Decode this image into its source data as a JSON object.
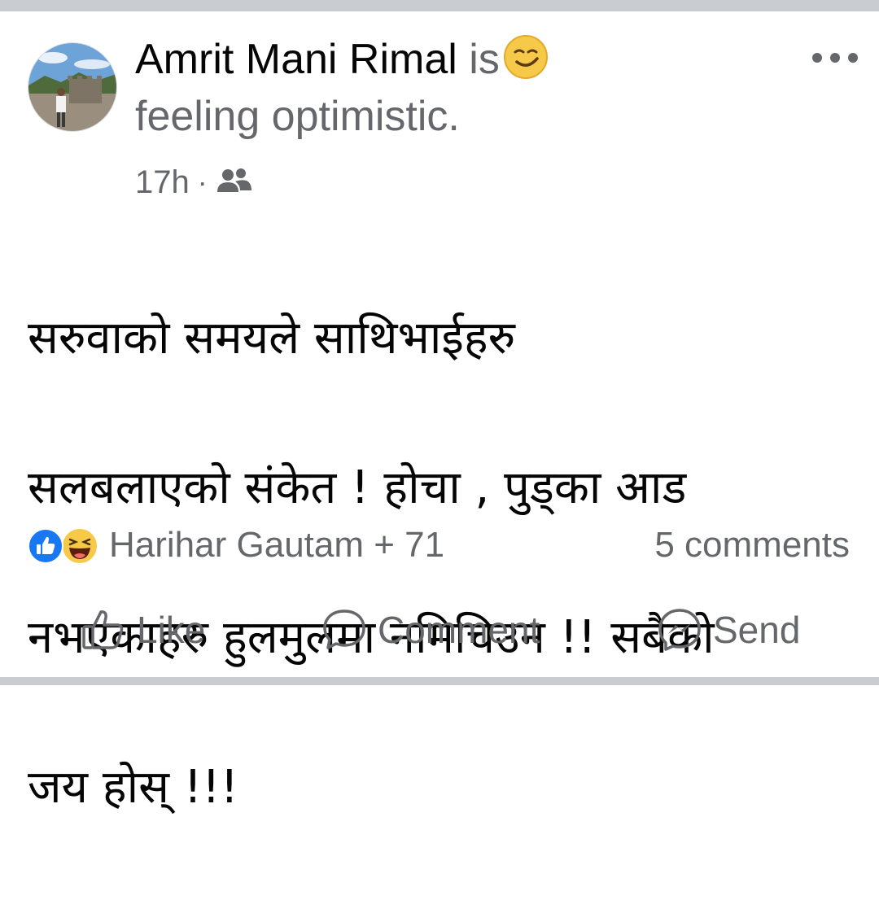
{
  "post": {
    "author": "Amrit Mani Rimal",
    "activity_prefix": "is",
    "feeling": "feeling optimistic.",
    "time": "17h",
    "separator": "·",
    "audience_icon": "friends-icon",
    "feeling_icon": "smirk-emoji-icon",
    "more_icon": "more-options-icon",
    "body_lines": [
      "सरुवाको समयले साथिभाईहरु",
      "सलबलाएको संकेत ! होचा , पुड्का आड",
      "नभएकाहरु हुलमुलमा नमिचिउन !! सबैको",
      "जय होस् !!!"
    ]
  },
  "reactions": {
    "icons": [
      "like-reaction-icon",
      "haha-reaction-icon"
    ],
    "summary": "Harihar Gautam + 71",
    "comments": "5 comments"
  },
  "actions": [
    {
      "label": "Like",
      "icon": "thumbs-up-icon"
    },
    {
      "label": "Comment",
      "icon": "comment-bubble-icon"
    },
    {
      "label": "Send",
      "icon": "messenger-icon"
    }
  ],
  "colors": {
    "text_primary": "#050505",
    "text_secondary": "#65676b",
    "separator": "#c9ccd1",
    "like_blue": "#1877f2",
    "emoji_yellow": "#f7c948"
  }
}
